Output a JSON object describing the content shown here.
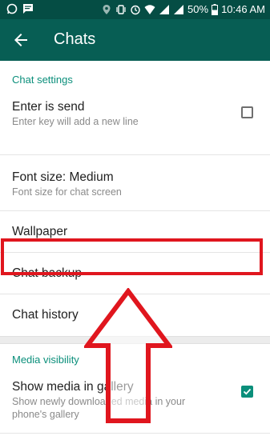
{
  "statusbar": {
    "battery": "50%",
    "time": "10:46 AM",
    "icons_left": [
      "whatsapp-icon",
      "message-icon"
    ],
    "icons_right": [
      "location-icon",
      "vibrate-icon",
      "alarm-icon",
      "wifi-icon",
      "signal-icon",
      "signal-icon",
      "battery-icon"
    ]
  },
  "toolbar": {
    "back_icon": "arrow-back-icon",
    "title": "Chats",
    "color": "#075e54"
  },
  "sections": {
    "chat_settings": {
      "header": "Chat settings",
      "enter_is_send": {
        "title": "Enter is send",
        "subtitle": "Enter key will add a new line",
        "checked": false
      },
      "font_size": {
        "title": "Font size: Medium",
        "subtitle": "Font size for chat screen"
      },
      "wallpaper": {
        "title": "Wallpaper"
      },
      "chat_backup": {
        "title": "Chat backup"
      },
      "chat_history": {
        "title": "Chat history"
      }
    },
    "media_visibility": {
      "header": "Media visibility",
      "show_media": {
        "title": "Show media in gallery",
        "subtitle": "Show newly downloaded media in your phone's gallery",
        "checked": true
      }
    }
  },
  "annotation": {
    "highlight_color": "#e0161e",
    "arrow_icon": "arrow-up-icon"
  }
}
